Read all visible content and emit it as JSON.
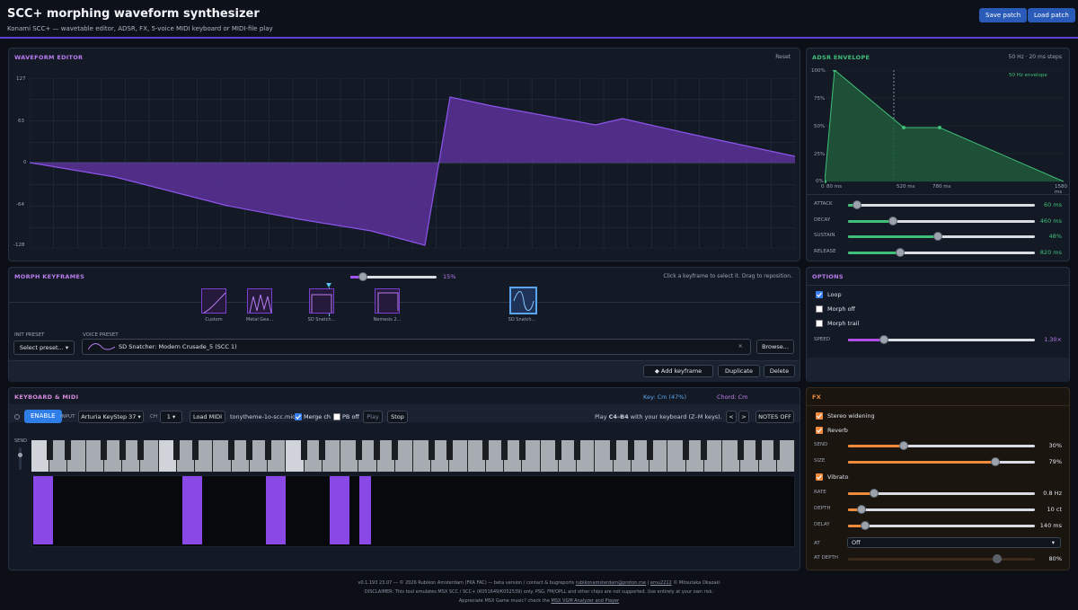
{
  "header": {
    "title": "SCC+ morphing waveform synthesizer",
    "subtitle": "Konami SCC+ — wavetable editor, ADSR, FX, 5-voice MIDI keyboard or MIDI-file play",
    "save": "Save patch",
    "load": "Load patch"
  },
  "wave": {
    "title": "WAVEFORM EDITOR",
    "reset": "Reset",
    "yticks": [
      "127",
      "63",
      "0",
      "-64",
      "-128"
    ]
  },
  "adsr": {
    "title": "ADSR ENVELOPE",
    "hint": "50 Hz · 20 ms steps",
    "legend": "50 Hz envelope",
    "yticks": [
      "100%",
      "75%",
      "50%",
      "25%",
      "0%"
    ],
    "xticks": [
      "0",
      "80 ms",
      "520 ms",
      "780 ms",
      "1580 ms"
    ],
    "params": [
      {
        "label": "ATTACK",
        "value": "60 ms",
        "level": 0.05
      },
      {
        "label": "DECAY",
        "value": "460 ms",
        "level": 0.24
      },
      {
        "label": "SUSTAIN",
        "value": "48%",
        "level": 0.48
      },
      {
        "label": "RELEASE",
        "value": "820 ms",
        "level": 0.28
      }
    ]
  },
  "morph": {
    "title": "MORPH KEYFRAMES",
    "pct": "15%",
    "level": 0.15,
    "hint": "Click a keyframe to select it. Drag to reposition.",
    "keyframes": [
      "Custom",
      "Metal Gea...",
      "SD Snatch...",
      "Nemesis 2...",
      "SD Snatch..."
    ],
    "init_label": "INIT PRESET",
    "init_value": "Select preset...",
    "voice_label": "VOICE PRESET",
    "voice_value": "SD Snatcher: Modern Crusade_5 (SCC 1)",
    "browse": "Browse...",
    "add": "◆ Add keyframe",
    "dup": "Duplicate",
    "del": "Delete"
  },
  "options": {
    "title": "OPTIONS",
    "loop": "Loop",
    "morph_off": "Morph off",
    "morph_trail": "Morph trail",
    "speed_label": "SPEED",
    "speed_value": "1.30×",
    "speed_level": 0.19
  },
  "kbd": {
    "title": "KEYBOARD & MIDI",
    "key": "Key: Cm (47%)",
    "chord": "Chord: Cm",
    "enable": "ENABLE",
    "input_label": "INPUT",
    "input_value": "Arturia KeyStep 37",
    "ch_label": "CH",
    "ch_value": "1",
    "load_midi": "Load MIDI",
    "file": "tonytheme-1o-scc.mid",
    "merge": "Merge ch",
    "pb": "PB off",
    "play": "Play",
    "stop": "Stop",
    "play_hint_pre": "Play",
    "play_hint_keys": "C4–B4",
    "play_hint_post": "with your keyboard (Z–M keys).",
    "prev": "<",
    "next": ">",
    "notes_off": "NOTES OFF",
    "send": "SEND"
  },
  "fx": {
    "title": "FX",
    "stereo": "Stereo widening",
    "reverb": "Reverb",
    "vibrato": "Vibrato",
    "at_label": "AT",
    "at_value": "Off",
    "params": [
      {
        "label": "SEND",
        "value": "30%",
        "level": 0.3
      },
      {
        "label": "SIZE",
        "value": "79%",
        "level": 0.79
      },
      {
        "label": "RATE",
        "value": "0.8 Hz",
        "level": 0.14
      },
      {
        "label": "DEPTH",
        "value": "10 ct",
        "level": 0.07
      },
      {
        "label": "DELAY",
        "value": "140 ms",
        "level": 0.09
      },
      {
        "label": "AT DEPTH",
        "value": "80%",
        "level": 0.8
      }
    ]
  },
  "footer": {
    "line1": "v0.1.193 23.07 — © 2026 Rubikon Amsterdam (FKA FAC) — beta version / contact & bugreports",
    "email": "rubikonamsterdam@proton.me",
    "line1b": "emu2212",
    "line1c": "© Mitsutaka Okazaki",
    "line2": "DISCLAIMER: This tool emulates MSX SCC / SCC+ (K051649/K052539) only. PSG, FM/OPLL and other chips are not supported. Use entirely at your own risk.",
    "line3": "Appreciate MSX Game music? check the",
    "link3": "MSX VGM Analyzer and Player"
  },
  "colors": {
    "accent": "#8a48e6",
    "adsr": "#3fbf78",
    "fx": "#ef8a3a",
    "button": "#2a5bb8"
  }
}
